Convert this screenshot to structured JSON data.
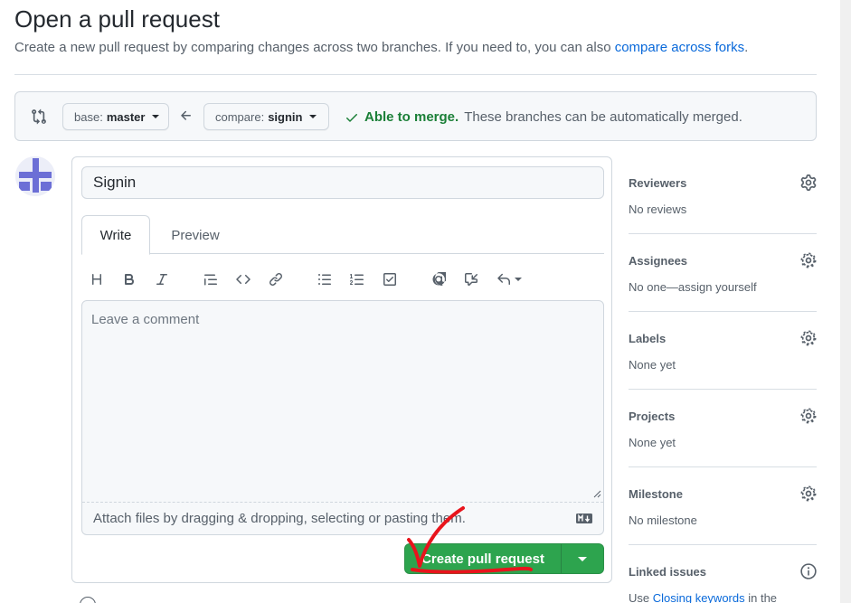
{
  "header": {
    "title": "Open a pull request",
    "description": "Create a new pull request by comparing changes across two branches. If you need to, you can also ",
    "compare_forks_link": "compare across forks",
    "description_end": "."
  },
  "range": {
    "base_prefix": "base:",
    "base_branch": "master",
    "compare_prefix": "compare:",
    "compare_branch": "signin",
    "merge_ok": "Able to merge.",
    "merge_text": "These branches can be automatically merged."
  },
  "form": {
    "title_value": "Signin",
    "tabs": {
      "write": "Write",
      "preview": "Preview"
    },
    "comment_placeholder": "Leave a comment",
    "attach_text": "Attach files by dragging & dropping, selecting or pasting them.",
    "submit_label": "Create pull request"
  },
  "toolbar_icons": [
    "heading-icon",
    "bold-icon",
    "italic-icon",
    "quote-icon",
    "code-icon",
    "link-icon",
    "bullet-list-icon",
    "numbered-list-icon",
    "task-list-icon",
    "mention-icon",
    "reference-icon",
    "reply-icon"
  ],
  "sidebar": {
    "sections": [
      {
        "heading": "Reviewers",
        "value": "No reviews"
      },
      {
        "heading": "Assignees",
        "value": "No one—assign yourself"
      },
      {
        "heading": "Labels",
        "value": "None yet"
      },
      {
        "heading": "Projects",
        "value": "None yet"
      },
      {
        "heading": "Milestone",
        "value": "No milestone"
      },
      {
        "heading": "Linked issues",
        "value_prefix": "Use ",
        "value_link": "Closing keywords",
        "value_suffix": " in the"
      }
    ]
  },
  "colors": {
    "accent_green": "#2da44e",
    "link_blue": "#0969da",
    "annotation_red": "#e8141c"
  }
}
